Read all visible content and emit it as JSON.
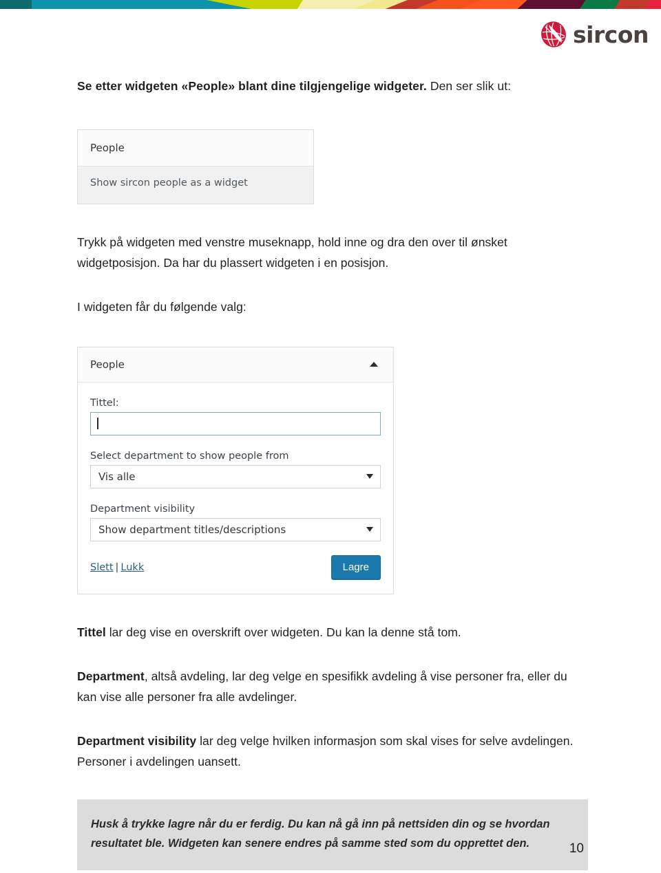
{
  "header": {
    "logo_word": "sircon",
    "logo_mark_name": "sircon-globe-logo",
    "brand_color": "#cf1b3b",
    "wordmark_color": "#4a423f",
    "band_colors": [
      "#0f6a6e",
      "#0e93ad",
      "#c8d400",
      "#f2efb3",
      "#f6f0a8",
      "#c0392b",
      "#f4511e",
      "#ff5722",
      "#5c0f2e",
      "#0b7a45",
      "#c0392b",
      "#e8213f"
    ]
  },
  "content": {
    "lead_bold": "Se etter widgeten «People» blant dine tilgjengelige widgeter.",
    "lead_normal": " Den ser slik ut:",
    "paragraph_drag": "Trykk på widgeten med venstre museknapp, hold inne og dra den over til ønsket widgetposisjon. Da har du plassert widgeten i en posisjon.",
    "paragraph_options": "I widgeten får du følgende valg:",
    "tittel_bold": "Tittel",
    "tittel_rest": " lar deg vise en overskrift over widgeten. Du kan la denne stå tom.",
    "department_bold": "Department",
    "department_rest": ", altså avdeling, lar deg velge en spesifikk avdeling å vise personer fra, eller du kan vise alle personer fra alle avdelinger.",
    "visibility_bold": "Department visibility",
    "visibility_rest": " lar deg velge hvilken informasjon som skal vises for selve avdelingen. Personer i avdelingen uansett."
  },
  "widget_list_card": {
    "title": "People",
    "description": "Show sircon people as a widget"
  },
  "widget_settings": {
    "panel_title": "People",
    "collapse_icon": "caret-up-icon",
    "tittel_label": "Tittel:",
    "tittel_value": "",
    "tittel_placeholder": "",
    "department_label": "Select department to show people from",
    "department_selected": "Vis alle",
    "department_options": [
      "Vis alle"
    ],
    "visibility_label": "Department visibility",
    "visibility_selected": "Show department titles/descriptions",
    "visibility_options": [
      "Show department titles/descriptions"
    ],
    "delete_link": "Slett",
    "separator": "|",
    "close_link": "Lukk",
    "save_button": "Lagre",
    "save_button_color": "#1a7aae",
    "link_color": "#2b5f85"
  },
  "callout": {
    "line1": "Husk å trykke lagre når du er ferdig. Du kan nå gå inn på nettsiden din og se hvordan",
    "line2": "resultatet ble. Widgeten kan senere endres på samme sted som du opprettet den.",
    "background": "#dcdcdc"
  },
  "footer": {
    "page_number": "10"
  }
}
